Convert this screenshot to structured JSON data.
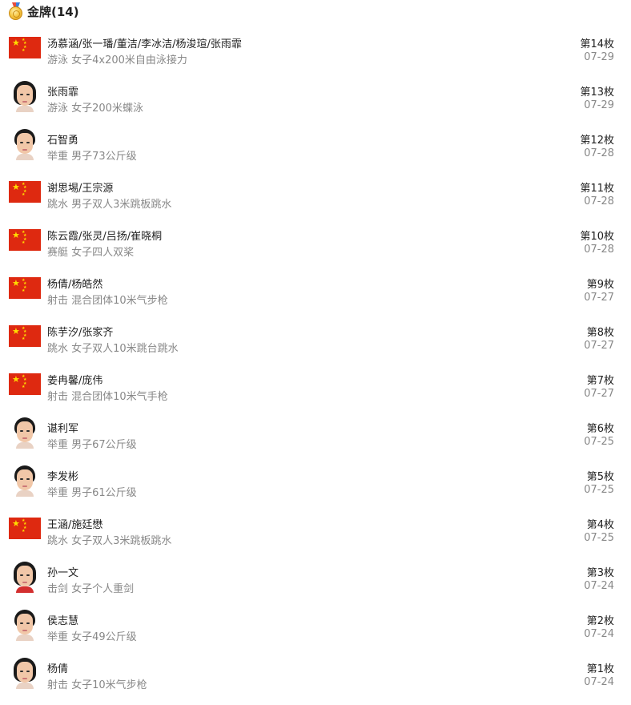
{
  "header": {
    "title": "金牌(14)",
    "icon": "gold-medal-icon"
  },
  "colors": {
    "flag_red": "#de2910",
    "flag_star": "#ffde00",
    "text_primary": "#222222",
    "text_secondary": "#888888"
  },
  "medals": [
    {
      "athletes": "汤慕涵/张一璠/董洁/李冰洁/杨浚瑄/张雨霏",
      "event": "游泳 女子4x200米自由泳接力",
      "medal_no": "第14枚",
      "date": "07-29",
      "avatar": "flag"
    },
    {
      "athletes": "张雨霏",
      "event": "游泳 女子200米蝶泳",
      "medal_no": "第13枚",
      "date": "07-29",
      "avatar": "photo"
    },
    {
      "athletes": "石智勇",
      "event": "举重 男子73公斤级",
      "medal_no": "第12枚",
      "date": "07-28",
      "avatar": "photo"
    },
    {
      "athletes": "谢思埸/王宗源",
      "event": "跳水 男子双人3米跳板跳水",
      "medal_no": "第11枚",
      "date": "07-28",
      "avatar": "flag"
    },
    {
      "athletes": "陈云霞/张灵/吕扬/崔晓桐",
      "event": "赛艇 女子四人双桨",
      "medal_no": "第10枚",
      "date": "07-28",
      "avatar": "flag"
    },
    {
      "athletes": "杨倩/杨皓然",
      "event": "射击 混合团体10米气步枪",
      "medal_no": "第9枚",
      "date": "07-27",
      "avatar": "flag"
    },
    {
      "athletes": "陈芋汐/张家齐",
      "event": "跳水 女子双人10米跳台跳水",
      "medal_no": "第8枚",
      "date": "07-27",
      "avatar": "flag"
    },
    {
      "athletes": "姜冉馨/庞伟",
      "event": "射击 混合团体10米气手枪",
      "medal_no": "第7枚",
      "date": "07-27",
      "avatar": "flag"
    },
    {
      "athletes": "谌利军",
      "event": "举重 男子67公斤级",
      "medal_no": "第6枚",
      "date": "07-25",
      "avatar": "photo"
    },
    {
      "athletes": "李发彬",
      "event": "举重 男子61公斤级",
      "medal_no": "第5枚",
      "date": "07-25",
      "avatar": "photo"
    },
    {
      "athletes": "王涵/施廷懋",
      "event": "跳水 女子双人3米跳板跳水",
      "medal_no": "第4枚",
      "date": "07-25",
      "avatar": "flag"
    },
    {
      "athletes": "孙一文",
      "event": "击剑 女子个人重剑",
      "medal_no": "第3枚",
      "date": "07-24",
      "avatar": "photo"
    },
    {
      "athletes": "侯志慧",
      "event": "举重 女子49公斤级",
      "medal_no": "第2枚",
      "date": "07-24",
      "avatar": "photo"
    },
    {
      "athletes": "杨倩",
      "event": "射击 女子10米气步枪",
      "medal_no": "第1枚",
      "date": "07-24",
      "avatar": "photo"
    }
  ]
}
